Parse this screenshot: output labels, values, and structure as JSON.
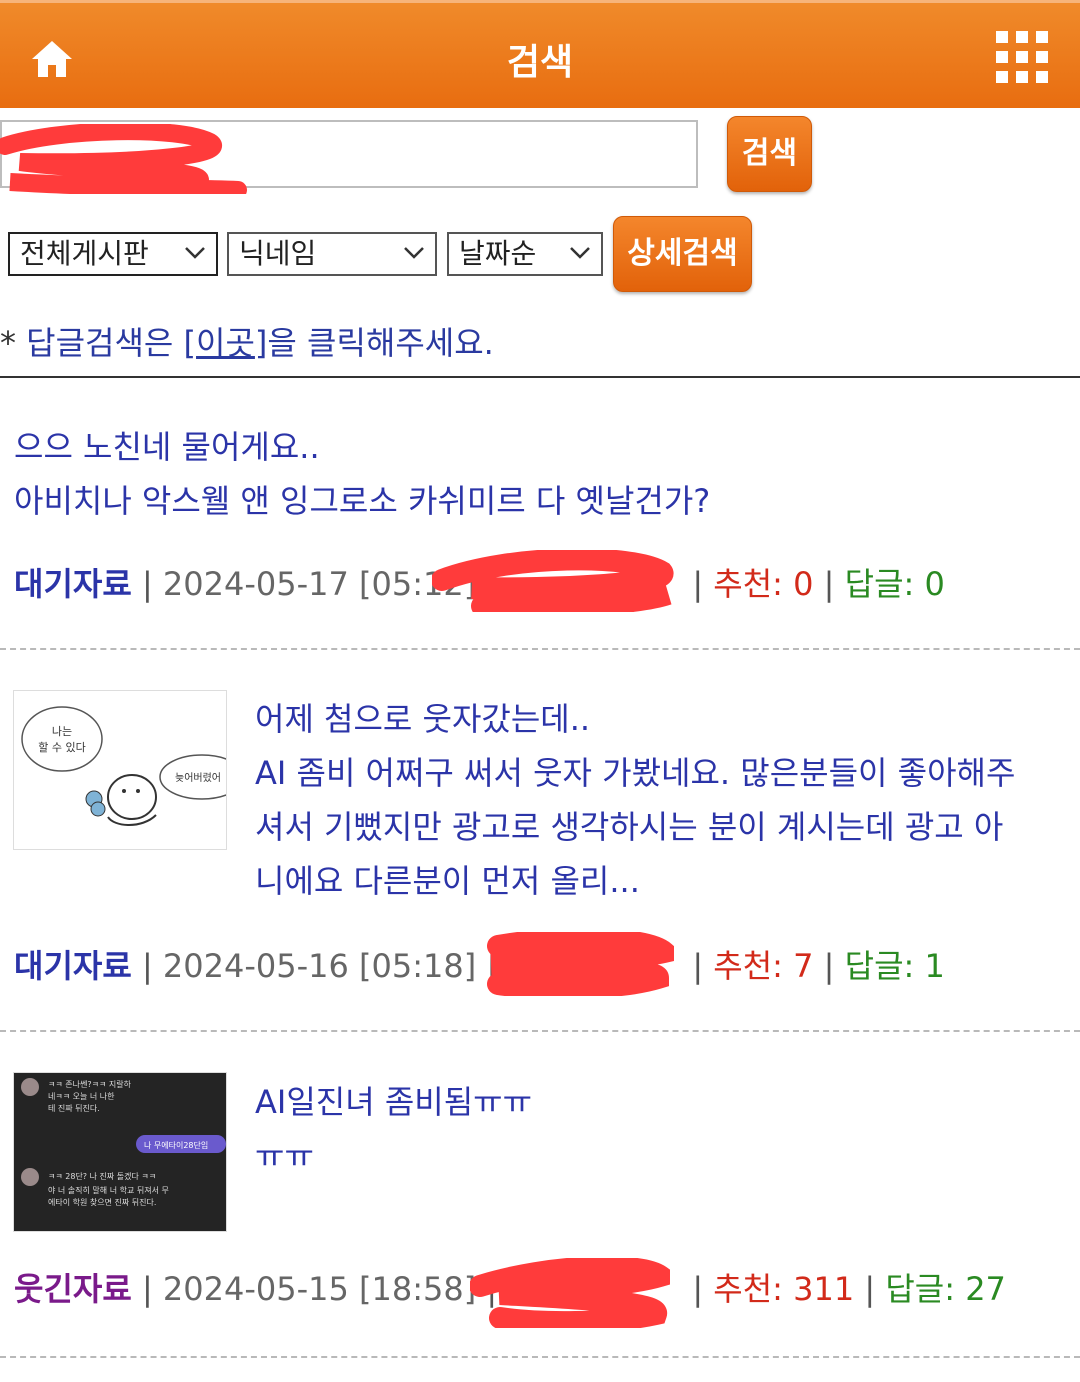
{
  "header": {
    "title": "검색",
    "home_icon": "home-icon",
    "menu_icon": "grid-menu-icon"
  },
  "search": {
    "value": "",
    "button_label": "검색"
  },
  "filters": {
    "board": "전체게시판",
    "field": "닉네임",
    "sort": "날짜순",
    "detail_button": "상세검색"
  },
  "reply_note": {
    "star": "*",
    "before": "답글검색은 [",
    "link": "이곳",
    "after": "]을 클릭해주세요."
  },
  "posts": [
    {
      "title": "으으 노친네 물어게요..",
      "body": "아비치나 악스웰 앤 잉그로소 카쉬미르 다 옛날건가?",
      "category": "대기자료",
      "datetime": "2024-05-17 [05:12]",
      "recommend_label": "추천:",
      "recommend": "0",
      "reply_label": "답글:",
      "replies": "0"
    },
    {
      "title": "어제 첨으로 웃자갔는데..",
      "body_lines": [
        "AI 좀비 어쩌구 써서 웃자 가봤네요. 많은분들이 좋아해주",
        "셔서 기뻤지만 광고로 생각하시는 분이 계시는데 광고 아",
        "니에요 다른분이 먼저 올리..."
      ],
      "thumb_text_1": "나는 할 수 있다",
      "thumb_text_2": "늦어버렸어",
      "category": "대기자료",
      "datetime": "2024-05-16 [05:18]",
      "recommend_label": "추천:",
      "recommend": "7",
      "reply_label": "답글:",
      "replies": "1"
    },
    {
      "title": "AI일진녀 좀비됨ㅠㅠ",
      "body": "ㅠㅠ",
      "thumb_lines": [
        "ㅋㅋ 존나쎈?ㅋㅋ 지랄하",
        "네ㅋㅋ 오늘 너 나한",
        "테 진짜 뒤진다.",
        "나 무에타이28단임",
        "ㅋㅋ 28단? 나 진짜 돌겠다 ㅋㅋ",
        "야 너 솔직히 말해 너 학교 뒤져서 무",
        "에타이 학원 찾으면 진짜 뒤진다."
      ],
      "category": "웃긴자료",
      "datetime": "2024-05-15 [18:58]",
      "recommend_label": "추천:",
      "recommend": "311",
      "reply_label": "답글:",
      "replies": "27"
    }
  ],
  "colors": {
    "header": "#ec7416",
    "link_blue": "#2b34a8",
    "recommend_red": "#d22a1a",
    "reply_green": "#2a8a22",
    "category_purple": "#7a1a8a"
  }
}
